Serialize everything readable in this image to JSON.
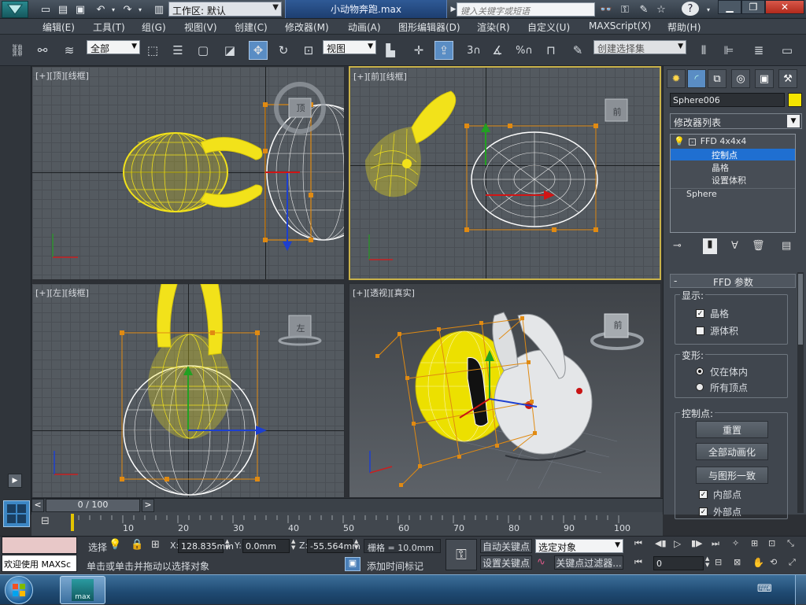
{
  "titlebar": {
    "workspace_label": "工作区: 默认",
    "file_name": "小动物奔跑.max",
    "search_placeholder": "键入关键字或短语",
    "help_icon": "?"
  },
  "menu": [
    "编辑(E)",
    "工具(T)",
    "组(G)",
    "视图(V)",
    "创建(C)",
    "修改器(M)",
    "动画(A)",
    "图形编辑器(D)",
    "渲染(R)",
    "自定义(U)",
    "MAXScript(X)",
    "帮助(H)"
  ],
  "toolbar": {
    "selection_filter": "全部",
    "ref_coord": "视图",
    "named_selection": "创建选择集",
    "snap_3": "3",
    "snap_percent": "%"
  },
  "viewports": {
    "top": {
      "label": "[+][顶][线框]"
    },
    "front": {
      "label": "[+][前][线框]"
    },
    "left": {
      "label": "[+][左][线框]"
    },
    "perspective": {
      "label": "[+][透视][真实]"
    }
  },
  "viewcube": {
    "top": "顶",
    "front": "前",
    "left": "左",
    "persp_face": "前"
  },
  "command_panel": {
    "object_name": "Sphere006",
    "object_color": "#f5e500",
    "modifier_list_label": "修改器列表",
    "stack": [
      {
        "label": "FFD 4x4x4",
        "level": 0
      },
      {
        "label": "控制点",
        "level": 1,
        "selected": true
      },
      {
        "label": "晶格",
        "level": 1
      },
      {
        "label": "设置体积",
        "level": 1
      },
      {
        "label": "Sphere",
        "level": 0
      }
    ],
    "rollout_title": "FFD 参数",
    "rollout_collapse": "-",
    "display_group": "显示:",
    "lattice_label": "晶格",
    "lattice_checked": true,
    "source_volume_label": "源体积",
    "source_volume_checked": false,
    "deform_group": "变形:",
    "only_in_volume": "仅在体内",
    "all_vertices": "所有顶点",
    "control_points_group": "控制点:",
    "reset_btn": "重置",
    "animate_all_btn": "全部动画化",
    "conform_btn": "与图形一致",
    "inside_points_label": "内部点",
    "inside_points_checked": true,
    "outside_points_label": "外部点",
    "outside_points_checked": true
  },
  "timeline": {
    "frame_display": "0 / 100",
    "prev": "<",
    "next": ">",
    "ticks": [
      "10",
      "20",
      "30",
      "40",
      "50",
      "60",
      "70",
      "80",
      "90",
      "100"
    ]
  },
  "status": {
    "welcome": "欢迎使用 MAXSc",
    "select_label": "选择",
    "x_label": "X:",
    "x_value": "128.835mm",
    "y_label": "Y:",
    "y_value": "0.0mm",
    "z_label": "Z:",
    "z_value": "-55.564mm",
    "grid_label": "栅格 = 10.0mm",
    "prompt": "单击或单击并拖动以选择对象",
    "add_time_tag": "添加时间标记",
    "auto_key": "自动关键点",
    "set_key": "设置关键点",
    "key_mode_select": "选定对象",
    "key_filters": "关键点过滤器...",
    "frame_field": "0"
  },
  "taskbar": {
    "max_label": "max"
  }
}
